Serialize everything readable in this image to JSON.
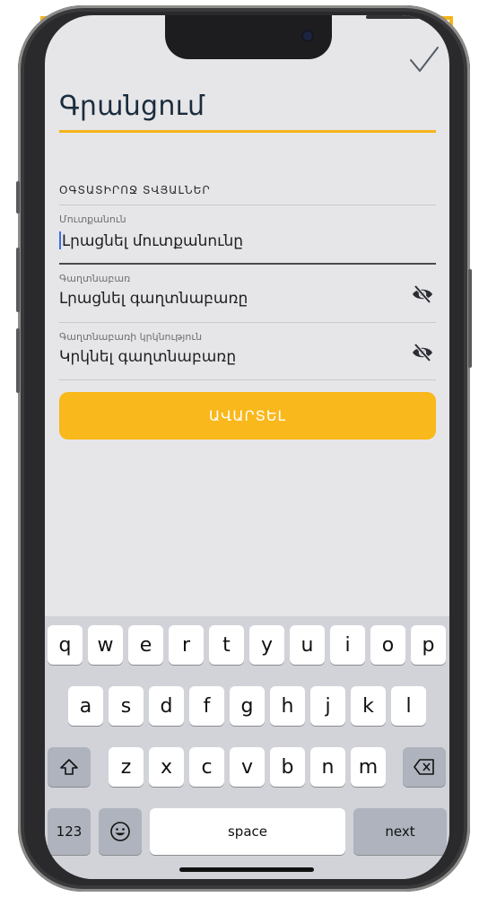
{
  "header": {
    "done_icon": "checkmark-icon",
    "title": "Գրանցում"
  },
  "form": {
    "section_title": "ՕԳՏԱՏԻՐՈՋ ՏՎՅԱԼՆԵՐ",
    "username": {
      "label": "Մուտքանուն",
      "placeholder": "Լրացնել մուտքանունը"
    },
    "password": {
      "label": "Գաղտնաբառ",
      "placeholder": "Լրացնել գաղտնաբառը",
      "icon": "eye-slash-icon"
    },
    "password_repeat": {
      "label": "Գաղտնաբառի կրկնություն",
      "placeholder": "Կրկնել գաղտնաբառը",
      "icon": "eye-slash-icon"
    },
    "submit_label": "ԱՎԱՐՏԵԼ"
  },
  "keyboard": {
    "row1": [
      "q",
      "w",
      "e",
      "r",
      "t",
      "y",
      "u",
      "i",
      "o",
      "p"
    ],
    "row2": [
      "a",
      "s",
      "d",
      "f",
      "g",
      "h",
      "j",
      "k",
      "l"
    ],
    "row3": [
      "z",
      "x",
      "c",
      "v",
      "b",
      "n",
      "m"
    ],
    "numbers_label": "123",
    "space_label": "space",
    "next_label": "next",
    "shift_icon": "shift-icon",
    "delete_icon": "backspace-icon",
    "emoji_icon": "emoji-icon"
  },
  "colors": {
    "accent": "#f9b81b",
    "title": "#1a2c3e",
    "screen_bg": "#e6e6e8",
    "keyboard_bg": "#d1d3d9"
  }
}
